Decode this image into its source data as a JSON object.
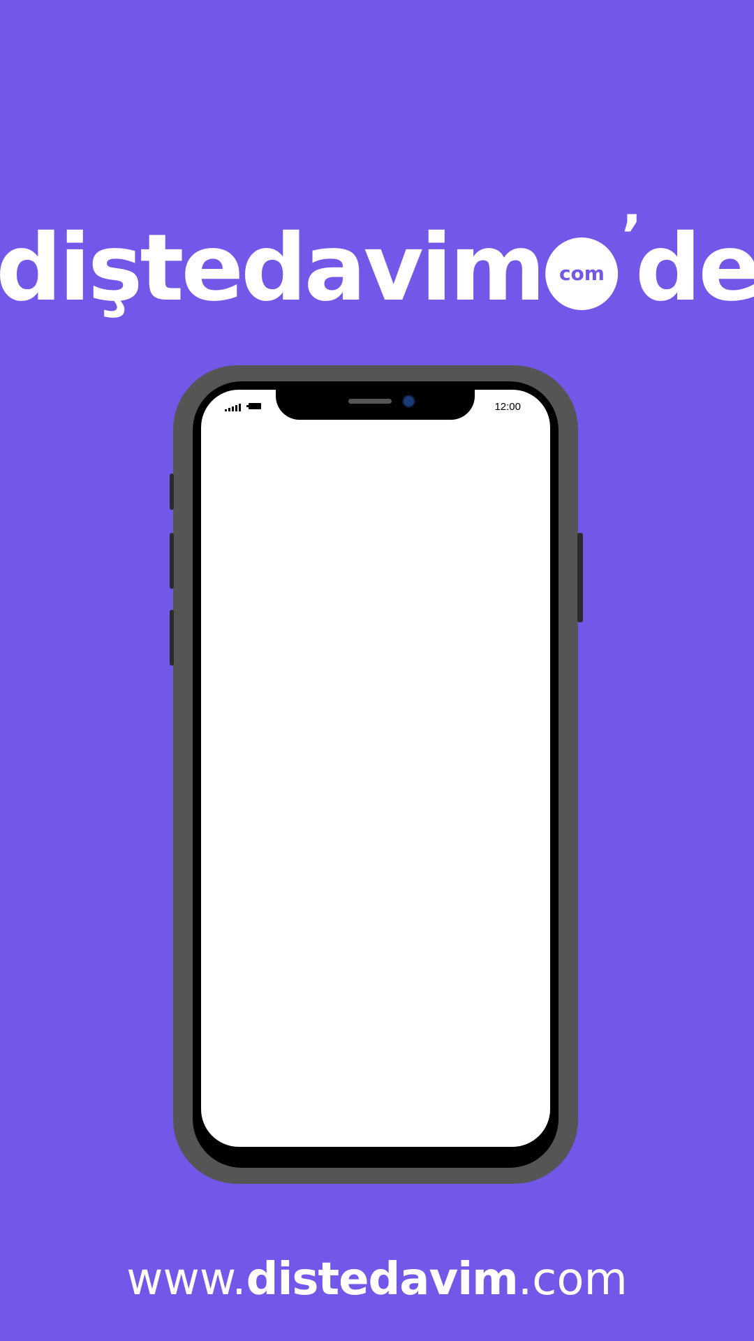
{
  "colors": {
    "background": "#7257e8",
    "foreground": "#ffffff",
    "phone_frame": "#555555",
    "phone_bezel": "#000000",
    "screen": "#ffffff"
  },
  "logo": {
    "text_main": "diştedavim",
    "badge": "com",
    "text_tail": "de"
  },
  "phone": {
    "status_bar": {
      "time": "12:00",
      "signal_icon": "signal-bars-icon",
      "battery_icon": "battery-icon"
    }
  },
  "website": {
    "prefix": "www.",
    "domain": "distedavim",
    "suffix": ".com"
  }
}
